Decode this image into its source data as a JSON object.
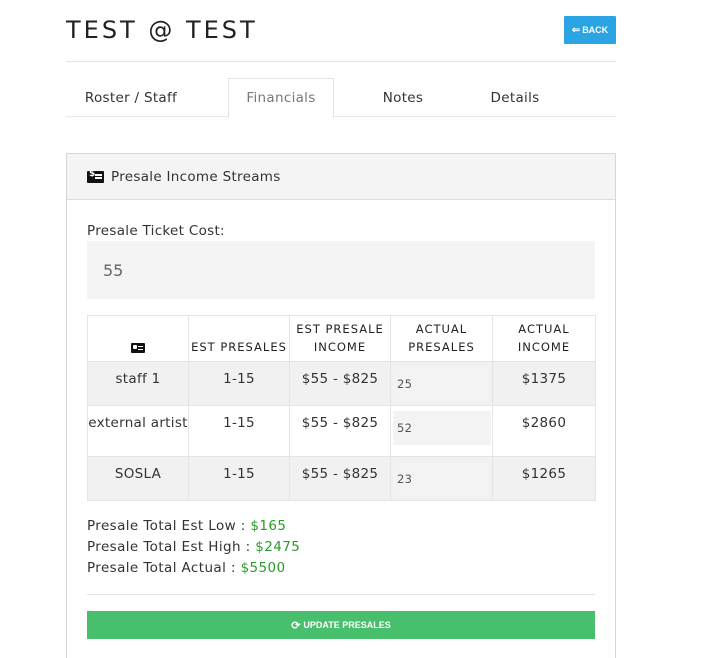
{
  "header": {
    "title": "TEST @ TEST",
    "back_label": "BACK",
    "back_icon": "arrow-left-icon"
  },
  "tabs": [
    {
      "label": "Roster / Staff",
      "active": false
    },
    {
      "label": "Financials",
      "active": true
    },
    {
      "label": "Notes",
      "active": false
    },
    {
      "label": "Details",
      "active": false
    }
  ],
  "panel": {
    "title": "Presale Income Streams",
    "icon": "money-bill-icon",
    "ticket_cost_label": "Presale Ticket Cost:",
    "ticket_cost_value": "55"
  },
  "table": {
    "headers": [
      "",
      "EST PRESALES",
      "EST PRESALE INCOME",
      "ACTUAL PRESALES",
      "ACTUAL INCOME"
    ],
    "header_icon": "id-card-icon",
    "rows": [
      {
        "name": "staff 1",
        "est_presales": "1-15",
        "est_income": "$55 - $825",
        "actual_presales": "25",
        "actual_income": "$1375"
      },
      {
        "name": "external artist",
        "est_presales": "1-15",
        "est_income": "$55 - $825",
        "actual_presales": "52",
        "actual_income": "$2860"
      },
      {
        "name": "SOSLA",
        "est_presales": "1-15",
        "est_income": "$55 - $825",
        "actual_presales": "23",
        "actual_income": "$1265"
      }
    ]
  },
  "totals": {
    "est_low_label": "Presale Total Est Low : ",
    "est_low_value": "$165",
    "est_high_label": "Presale Total Est High : ",
    "est_high_value": "$2475",
    "actual_label": "Presale Total Actual : ",
    "actual_value": "$5500"
  },
  "update_button": {
    "label": "UPDATE PRESALES",
    "icon": "refresh-icon"
  },
  "colors": {
    "back_button": "#2ba4e3",
    "update_button": "#48bf6d",
    "total_values": "#2b9b2b"
  }
}
